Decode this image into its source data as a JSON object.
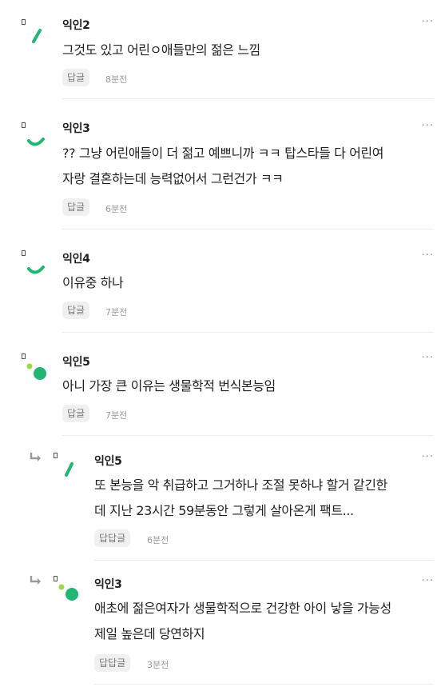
{
  "reply_label": "답글",
  "nested_reply_label": "답답글",
  "comments": [
    {
      "author": "익인2",
      "text": "그것도 있고 어린ㅇ애들만의 젊은 느낌",
      "time": "8분전",
      "avatar": "slash-icon"
    },
    {
      "author": "익인3",
      "text": "?? 그냥 어린애들이 더 젊고 예쁘니까 ㅋㅋ 탑스타들 다 어린여\n자랑 결혼하는데 능력없어서 그런건가 ㅋㅋ",
      "time": "6분전",
      "avatar": "smile-icon"
    },
    {
      "author": "익인4",
      "text": "이유중 하나",
      "time": "7분전",
      "avatar": "smile-icon"
    },
    {
      "author": "익인5",
      "text": "아니 가장 큰 이유는 생물학적 번식본능임",
      "time": "7분전",
      "avatar": "dots-icon"
    },
    {
      "author": "익인5",
      "text": "또 본능을 악 취급하고 그거하나 조절 못하냐 할거 같긴한\n데 지난 23시간 59분동안 그렇게 살아온게 팩트...",
      "time": "6분전",
      "avatar": "slash-icon"
    },
    {
      "author": "익인3",
      "text": "애초에 젊은여자가 생물학적으로 건강한 아이 낳을 가능성\n제일 높은데 당연하지",
      "time": "3분전",
      "avatar": "dots-icon"
    }
  ],
  "more_label": "···",
  "colors": {
    "accent": "#22b573",
    "light_accent": "#9bd94a"
  }
}
